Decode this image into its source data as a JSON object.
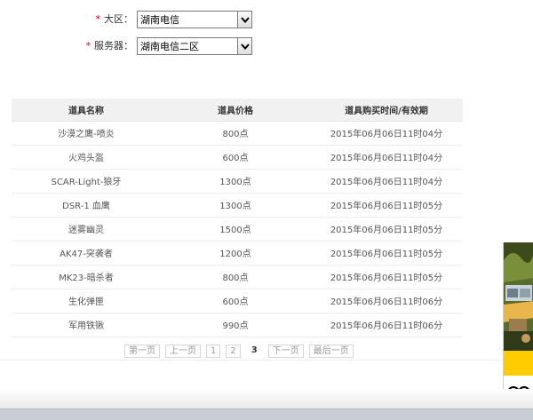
{
  "form": {
    "region": {
      "required_mark": "*",
      "label": "大区：",
      "value": "湖南电信"
    },
    "server": {
      "required_mark": "*",
      "label": "服务器：",
      "value": "湖南电信二区"
    }
  },
  "table": {
    "headers": {
      "name": "道具名称",
      "price": "道具价格",
      "time": "道具购买时间/有效期"
    },
    "rows": [
      {
        "name": "沙漠之鹰-喷炎",
        "price": "800点",
        "time": "2015年06月06日11时04分"
      },
      {
        "name": "火鸡头盔",
        "price": "600点",
        "time": "2015年06月06日11时04分"
      },
      {
        "name": "SCAR-Light-狼牙",
        "price": "1300点",
        "time": "2015年06月06日11时04分"
      },
      {
        "name": "DSR-1 血鹰",
        "price": "1300点",
        "time": "2015年06月06日11时05分"
      },
      {
        "name": "迷雾幽灵",
        "price": "1500点",
        "time": "2015年06月06日11时05分"
      },
      {
        "name": "AK47-突袭者",
        "price": "1200点",
        "time": "2015年06月06日11时05分"
      },
      {
        "name": "MK23-暗杀者",
        "price": "800点",
        "time": "2015年06月06日11时05分"
      },
      {
        "name": "生化弹匣",
        "price": "600点",
        "time": "2015年06月06日11时06分"
      },
      {
        "name": "军用铁锹",
        "price": "990点",
        "time": "2015年06月06日11时06分"
      }
    ]
  },
  "pagination": {
    "first": "第一页",
    "prev": "上一页",
    "pages": [
      "1",
      "2"
    ],
    "current": "3",
    "next": "下一页",
    "last": "最后一页"
  },
  "colors": {
    "required": "#d0021b",
    "header_bg": "#f1f1f1",
    "ad_yellow": "#ffcc00"
  },
  "icons": {
    "select_arrow": "chevron-down-icon",
    "ad_logo": "owl-logo-icon"
  }
}
